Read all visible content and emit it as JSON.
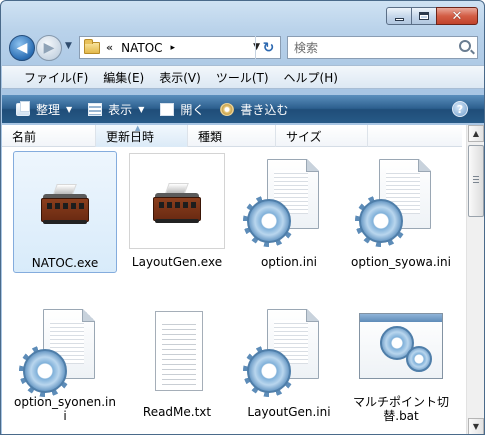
{
  "window": {
    "minimize_label": "",
    "maximize_label": "",
    "close_label": "✕"
  },
  "navigation": {
    "back_glyph": "◀",
    "forward_glyph": "▶",
    "address_prefix": "«",
    "address_folder": "NATOC",
    "address_arrow": "▸",
    "refresh_glyph": "↻",
    "search_placeholder": "検索"
  },
  "menu": {
    "items": [
      "ファイル(F)",
      "編集(E)",
      "表示(V)",
      "ツール(T)",
      "ヘルプ(H)"
    ]
  },
  "toolbar": {
    "organize": "整理",
    "views": "表示",
    "open": "開く",
    "burn": "書き込む",
    "help": "?"
  },
  "columns": {
    "headers": [
      "名前",
      "更新日時",
      "種類",
      "サイズ"
    ],
    "sorted_column": "更新日時"
  },
  "files": [
    {
      "name": "NATOC.exe",
      "icon": "train-exe-icon",
      "selected": true
    },
    {
      "name": "LayoutGen.exe",
      "icon": "train-exe-icon",
      "selected": false
    },
    {
      "name": "option.ini",
      "icon": "ini-settings-icon",
      "selected": false
    },
    {
      "name": "option_syowa.ini",
      "icon": "ini-settings-icon",
      "selected": false
    },
    {
      "name": "option_syonen.ini",
      "icon": "ini-settings-icon",
      "selected": false
    },
    {
      "name": "ReadMe.txt",
      "icon": "text-file-icon",
      "selected": false
    },
    {
      "name": "LayoutGen.ini",
      "icon": "ini-settings-icon",
      "selected": false
    },
    {
      "name": "マルチポイント切替.bat",
      "icon": "batch-file-icon",
      "selected": false
    }
  ],
  "colors": {
    "toolbar_blue": "#2c5f8e",
    "selection": "#d8ebfa",
    "close_red": "#c1432b"
  }
}
